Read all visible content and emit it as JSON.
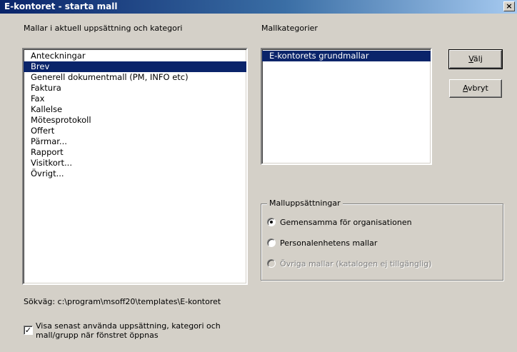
{
  "window": {
    "title": "E-kontoret - starta mall",
    "close_glyph": "×"
  },
  "templates": {
    "label": "Mallar i aktuell uppsättning och kategori",
    "items": [
      "Anteckningar",
      "Brev",
      "Generell dokumentmall (PM, INFO etc)",
      "Faktura",
      "Fax",
      "Kallelse",
      "Mötesprotokoll",
      "Offert",
      "Pärmar...",
      "Rapport",
      "Visitkort...",
      "Övrigt..."
    ],
    "selected": "Brev"
  },
  "categories": {
    "label": "Mallkategorier",
    "items": [
      "E-kontorets grundmallar"
    ],
    "selected": "E-kontorets grundmallar"
  },
  "buttons": {
    "choose": {
      "first": "V",
      "rest": "älj"
    },
    "cancel": {
      "first": "A",
      "rest": "vbryt"
    }
  },
  "template_sets": {
    "legend": "Malluppsättningar",
    "options": [
      {
        "label": "Gemensamma för organisationen",
        "checked": true,
        "enabled": true
      },
      {
        "label": "Personalenhetens mallar",
        "checked": false,
        "enabled": true
      },
      {
        "label": "Övriga mallar (katalogen ej tillgänglig)",
        "checked": false,
        "enabled": false
      }
    ]
  },
  "path": {
    "text": "Sökväg: c:\\program\\msoff20\\templates\\E-kontoret"
  },
  "remember": {
    "checked": true,
    "check_glyph": "✓",
    "line1": "Visa senast använda uppsättning, kategori och",
    "line2": "mall/grupp när fönstret öppnas"
  }
}
